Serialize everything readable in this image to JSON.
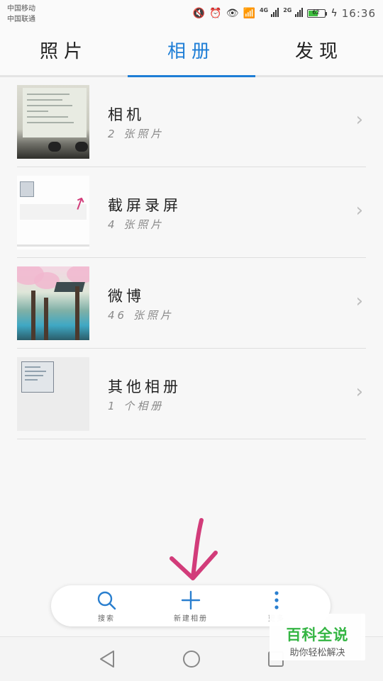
{
  "status_bar": {
    "carrier_1": "中国移动",
    "carrier_2": "中国联通",
    "net_1": "4G",
    "net_2": "2G",
    "battery_level": "62",
    "time": "16:36"
  },
  "tabs": [
    {
      "label": "照片",
      "active": false
    },
    {
      "label": "相册",
      "active": true
    },
    {
      "label": "发现",
      "active": false
    }
  ],
  "albums": [
    {
      "title": "相机",
      "subtitle": "2 张照片"
    },
    {
      "title": "截屏录屏",
      "subtitle": "4 张照片"
    },
    {
      "title": "微博",
      "subtitle": "46 张照片"
    },
    {
      "title": "其他相册",
      "subtitle": "1 个相册"
    }
  ],
  "toolbar": {
    "search_label": "搜索",
    "new_album_label": "新建相册",
    "more_label": "更多"
  },
  "watermark": {
    "title": "百科全说",
    "subtitle": "助你轻松解决"
  },
  "colors": {
    "accent": "#1e7ed6",
    "annotation": "#d23c7a",
    "watermark_green": "#2eb33e"
  }
}
